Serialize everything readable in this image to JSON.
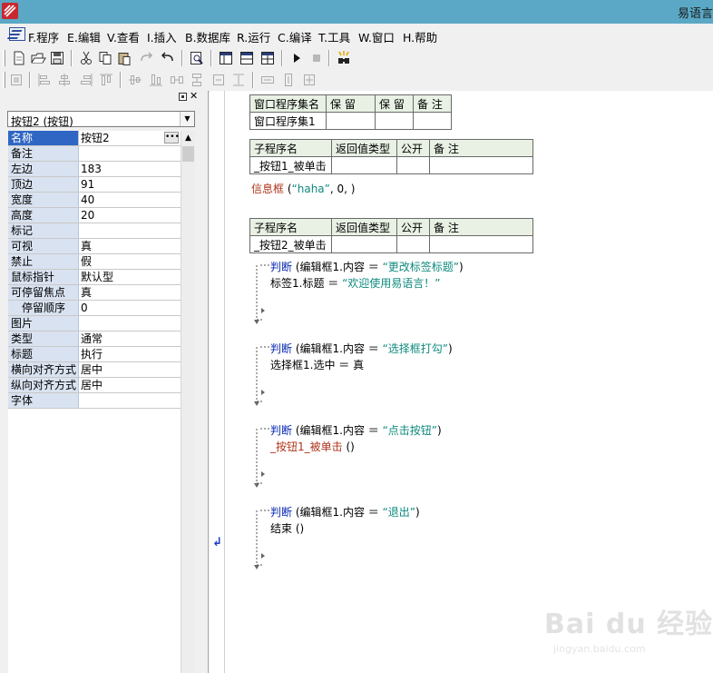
{
  "window": {
    "title": "易语言"
  },
  "menu": [
    "F.程序",
    "E.编辑",
    "V.查看",
    "I.插入",
    "B.数据库",
    "R.运行",
    "C.编译",
    "T.工具",
    "W.窗口",
    "H.帮助"
  ],
  "property_panel": {
    "selected_object": "按钮2 (按钮)",
    "properties": [
      {
        "name": "名称",
        "value": "按钮2"
      },
      {
        "name": "备注",
        "value": ""
      },
      {
        "name": "左边",
        "value": "183"
      },
      {
        "name": "顶边",
        "value": "91"
      },
      {
        "name": "宽度",
        "value": "40"
      },
      {
        "name": "高度",
        "value": "20"
      },
      {
        "name": "标记",
        "value": ""
      },
      {
        "name": "可视",
        "value": "真"
      },
      {
        "name": "禁止",
        "value": "假"
      },
      {
        "name": "鼠标指针",
        "value": "默认型"
      },
      {
        "name": "可停留焦点",
        "value": "真"
      },
      {
        "name": "停留顺序",
        "value": "0"
      },
      {
        "name": "图片",
        "value": ""
      },
      {
        "name": "类型",
        "value": "通常"
      },
      {
        "name": "标题",
        "value": "执行"
      },
      {
        "name": "横向对齐方式",
        "value": "居中"
      },
      {
        "name": "纵向对齐方式",
        "value": "居中"
      },
      {
        "name": "字体",
        "value": ""
      }
    ]
  },
  "code": {
    "assembly_table": {
      "headers": [
        "窗口程序集名",
        "保 留",
        "保 留",
        "备 注"
      ],
      "row": [
        "窗口程序集1",
        "",
        "",
        ""
      ]
    },
    "sub_headers": [
      "子程序名",
      "返回值类型",
      "公开",
      "备 注"
    ],
    "sub1": {
      "name": "_按钮1_被单击",
      "line": {
        "func": "信息框",
        "open": " (",
        "arg": "“haha”",
        "rest": ", 0, )"
      }
    },
    "sub2": {
      "name": "_按钮2_被单击"
    },
    "blocks": [
      {
        "kw": "判断",
        "cond_plain": " (编辑框1.内容 ＝ ",
        "cond_str": "“更改标签标题”",
        "cond_end": ")",
        "body_plain": "标签1.标题 ＝ ",
        "body_str": "“欢迎使用易语言！”",
        "body_func": ""
      },
      {
        "kw": "判断",
        "cond_plain": " (编辑框1.内容 ＝ ",
        "cond_str": "“选择框打勾”",
        "cond_end": ")",
        "body_plain": "选择框1.选中 ＝ 真",
        "body_str": "",
        "body_func": ""
      },
      {
        "kw": "判断",
        "cond_plain": " (编辑框1.内容 ＝ ",
        "cond_str": "“点击按钮”",
        "cond_end": ")",
        "body_plain": " ()",
        "body_str": "",
        "body_func": "_按钮1_被单击"
      },
      {
        "kw": "判断",
        "cond_plain": " (编辑框1.内容 ＝ ",
        "cond_str": "“退出”",
        "cond_end": ")",
        "body_plain": "结束 ()",
        "body_str": "",
        "body_func": ""
      }
    ]
  },
  "watermark": {
    "logo": "Bai du 经验",
    "site": "jingyan.baidu.com"
  },
  "icons": {
    "toolbar1": [
      "new-file-icon",
      "open-folder-icon",
      "save-icon",
      "cut-icon",
      "copy-icon",
      "paste-icon",
      "redo-icon",
      "undo-icon",
      "find-icon",
      "layout-icon-1",
      "layout-icon-2",
      "layout-icon-3",
      "run-icon",
      "stop-icon",
      "debug-icon"
    ],
    "toolbar2": [
      "align-icon",
      "align-left-icon",
      "align-center-icon",
      "align-right-icon",
      "align-top-icon",
      "align-middle-icon",
      "align-bottom-icon",
      "space-h-icon",
      "space-v-icon",
      "center-h-icon",
      "center-v-icon"
    ]
  },
  "colors": {
    "titlebar": "#5aa8c5",
    "selected": "#2f66c4",
    "keyword": "#0a2ab3",
    "string": "#0f8a7e",
    "function": "#b0351c",
    "table_header": "#e8f1e4"
  }
}
